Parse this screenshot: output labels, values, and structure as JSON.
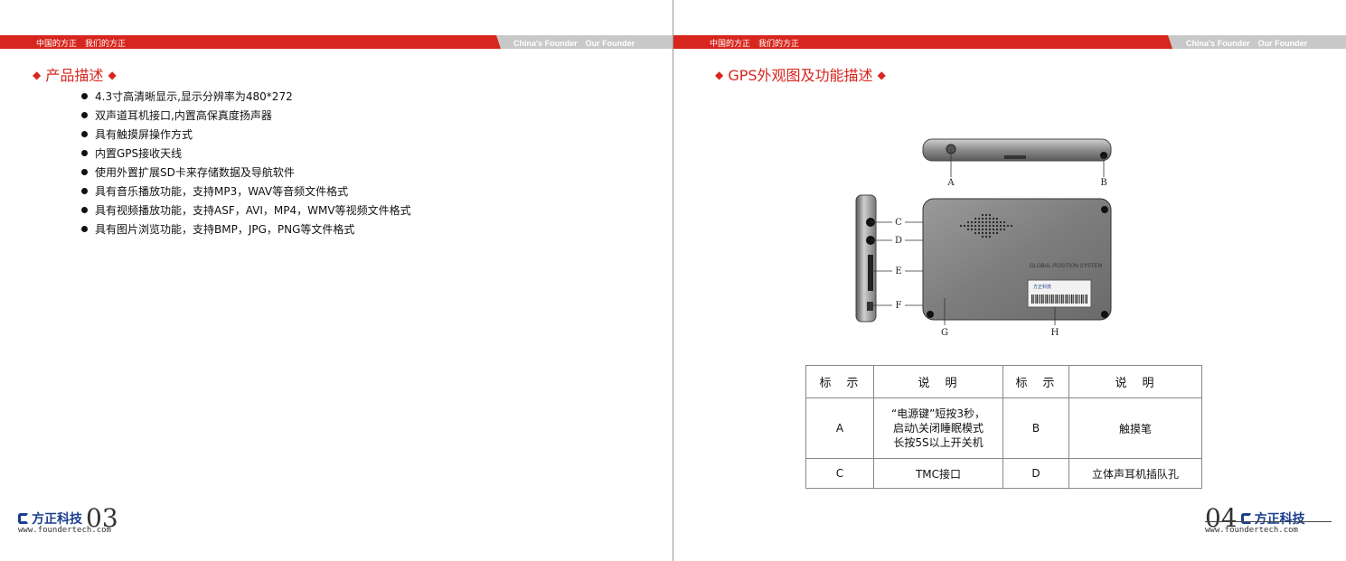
{
  "left": {
    "band_cn": "中国的方正　我们的方正",
    "band_en": "China's Founder　Our Founder",
    "section_title": "产品描述",
    "features": [
      "4.3寸高清晰显示,显示分辨率为480*272",
      "双声道耳机接口,内置高保真度扬声器",
      "具有触摸屏操作方式",
      "内置GPS接收天线",
      "使用外置扩展SD卡来存储数据及导航软件",
      "具有音乐播放功能，支持MP3，WAV等音频文件格式",
      "具有视频播放功能，支持ASF，AVI，MP4，WMV等视频文件格式",
      "具有图片浏览功能，支持BMP，JPG，PNG等文件格式"
    ],
    "brand": "方正科技",
    "page_number": "03",
    "url": "www.foundertech.com"
  },
  "right": {
    "band_cn": "中国的方正　我们的方正",
    "band_en": "China's Founder　Our Founder",
    "section_title": "GPS外观图及功能描述",
    "device": {
      "labels": [
        "A",
        "B",
        "C",
        "D",
        "E",
        "F",
        "G",
        "H"
      ],
      "back_print": "GLOBAL POSITION SYSTEM",
      "sticker_brand": "方正科技"
    },
    "table": {
      "headers": [
        "标　示",
        "说　明",
        "标　示",
        "说　明"
      ],
      "rows": [
        {
          "k1": "A",
          "v1": [
            "“电源键”短按3秒，",
            "启动\\关闭睡眠模式",
            "长按5S以上开关机"
          ],
          "k2": "B",
          "v2": "触摸笔"
        },
        {
          "k1": "C",
          "v1": [
            "TMC接口"
          ],
          "k2": "D",
          "v2": "立体声耳机插队孔"
        }
      ]
    },
    "brand": "方正科技",
    "page_number": "04",
    "url": "www.foundertech.com"
  },
  "colors": {
    "accent": "#d7261e",
    "band_grey": "#c8c8c8",
    "brand_blue": "#1a3f8f"
  }
}
